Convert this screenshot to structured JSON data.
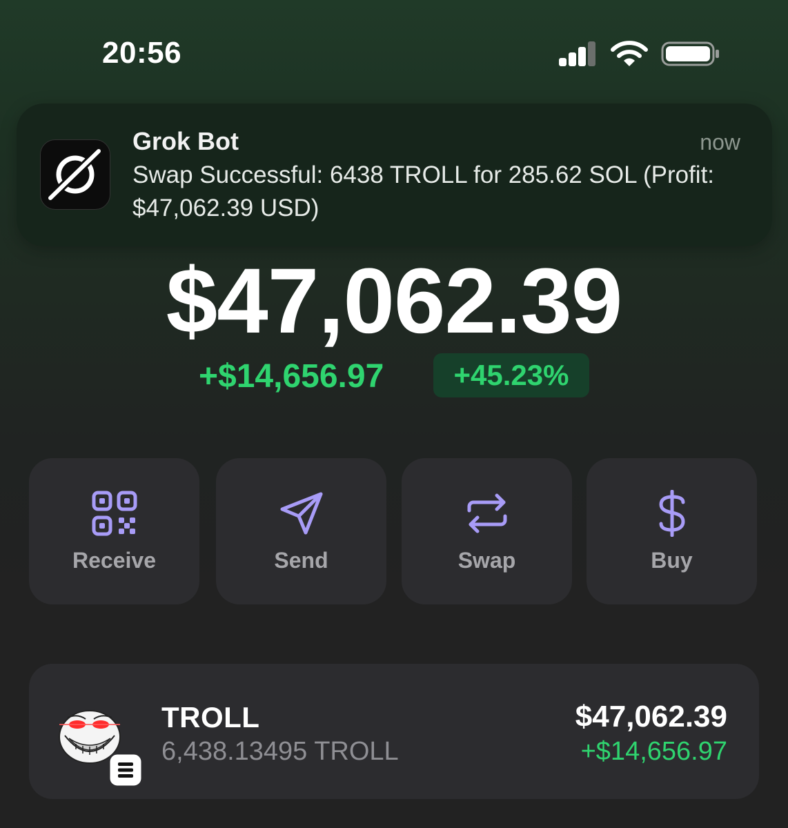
{
  "status_bar": {
    "time": "20:56",
    "signal_icon": "cellular-signal-icon",
    "wifi_icon": "wifi-icon",
    "battery_icon": "battery-icon"
  },
  "notification": {
    "app_name": "Grok Bot",
    "time": "now",
    "message": "Swap Successful: 6438 TROLL for 285.62 SOL (Profit: $47,062.39 USD)",
    "icon": "grok-logo-icon"
  },
  "portfolio": {
    "balance": "$47,062.39",
    "change_amount": "+$14,656.97",
    "change_percent": "+45.23%"
  },
  "actions": [
    {
      "label": "Receive",
      "icon": "qr-code-icon"
    },
    {
      "label": "Send",
      "icon": "send-icon"
    },
    {
      "label": "Swap",
      "icon": "swap-icon"
    },
    {
      "label": "Buy",
      "icon": "dollar-icon"
    }
  ],
  "tokens": [
    {
      "name": "TROLL",
      "quantity": "6,438.13495 TROLL",
      "value": "$47,062.39",
      "change": "+$14,656.97",
      "icon": "troll-face-icon",
      "chain_badge_icon": "solana-badge-icon"
    }
  ],
  "colors": {
    "positive": "#2fd46f",
    "accent_icon": "#a89cf7",
    "card_bg": "#2c2c2f"
  }
}
